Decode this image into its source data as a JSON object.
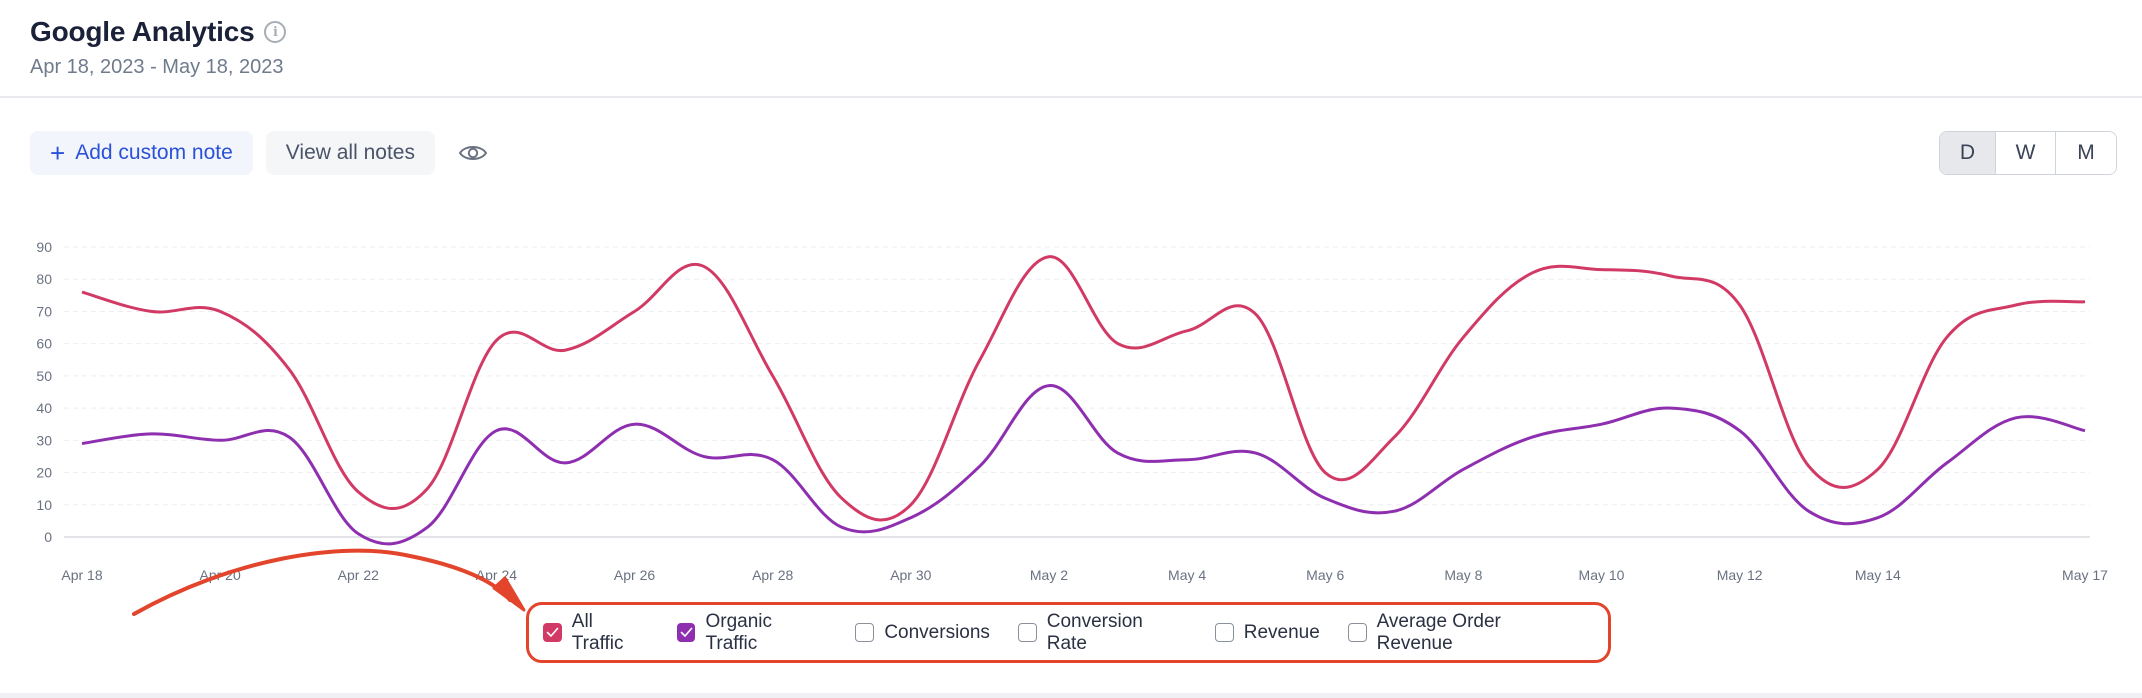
{
  "header": {
    "title": "Google Analytics",
    "info_icon": "info-icon",
    "date_range": "Apr 18, 2023 - May 18, 2023"
  },
  "toolbar": {
    "add_note_icon": "+",
    "add_note_label": "Add custom note",
    "view_notes_label": "View all notes",
    "visibility_icon": "eye-icon"
  },
  "period_toggle": {
    "options": [
      "D",
      "W",
      "M"
    ],
    "selected": "D"
  },
  "legend": {
    "items": [
      {
        "label": "All Traffic",
        "checked": true,
        "color": "#d23a66"
      },
      {
        "label": "Organic Traffic",
        "checked": true,
        "color": "#8e2fb0"
      },
      {
        "label": "Conversions",
        "checked": false
      },
      {
        "label": "Conversion Rate",
        "checked": false
      },
      {
        "label": "Revenue",
        "checked": false
      },
      {
        "label": "Average Order Revenue",
        "checked": false
      }
    ]
  },
  "annotation": {
    "color": "#e3452c",
    "type": "arrow pointing to legend with highlight box"
  },
  "chart_data": {
    "type": "line",
    "title": "",
    "xlabel": "",
    "ylabel": "",
    "ylim": [
      0,
      90
    ],
    "yticks": [
      0,
      10,
      20,
      30,
      40,
      50,
      60,
      70,
      80,
      90
    ],
    "grid": true,
    "smooth": true,
    "x": [
      "Apr 18",
      "Apr 19",
      "Apr 20",
      "Apr 21",
      "Apr 22",
      "Apr 23",
      "Apr 24",
      "Apr 25",
      "Apr 26",
      "Apr 27",
      "Apr 28",
      "Apr 29",
      "Apr 30",
      "May 1",
      "May 2",
      "May 3",
      "May 4",
      "May 5",
      "May 6",
      "May 7",
      "May 8",
      "May 9",
      "May 10",
      "May 11",
      "May 12",
      "May 13",
      "May 14",
      "May 15",
      "May 16",
      "May 17"
    ],
    "xtick_labels": [
      {
        "index": 0,
        "label": "Apr 18"
      },
      {
        "index": 2,
        "label": "Apr 20"
      },
      {
        "index": 4,
        "label": "Apr 22"
      },
      {
        "index": 6,
        "label": "Apr 24"
      },
      {
        "index": 8,
        "label": "Apr 26"
      },
      {
        "index": 10,
        "label": "Apr 28"
      },
      {
        "index": 12,
        "label": "Apr 30"
      },
      {
        "index": 14,
        "label": "May 2"
      },
      {
        "index": 16,
        "label": "May 4"
      },
      {
        "index": 18,
        "label": "May 6"
      },
      {
        "index": 20,
        "label": "May 8"
      },
      {
        "index": 22,
        "label": "May 10"
      },
      {
        "index": 24,
        "label": "May 12"
      },
      {
        "index": 26,
        "label": "May 14"
      },
      {
        "index": 29,
        "label": "May 17"
      }
    ],
    "series": [
      {
        "name": "All Traffic",
        "color": "#d23a66",
        "values": [
          76,
          70,
          70,
          52,
          14,
          15,
          61,
          58,
          70,
          84,
          50,
          12,
          10,
          55,
          87,
          60,
          64,
          69,
          20,
          31,
          62,
          82,
          83,
          81,
          72,
          22,
          21,
          62,
          72,
          73
        ]
      },
      {
        "name": "Organic Traffic",
        "color": "#8e2fb0",
        "values": [
          29,
          32,
          30,
          31,
          1,
          3,
          33,
          23,
          35,
          25,
          24,
          3,
          6,
          22,
          47,
          26,
          24,
          26,
          12,
          8,
          21,
          31,
          35,
          40,
          33,
          8,
          6,
          23,
          37,
          33
        ]
      }
    ]
  }
}
